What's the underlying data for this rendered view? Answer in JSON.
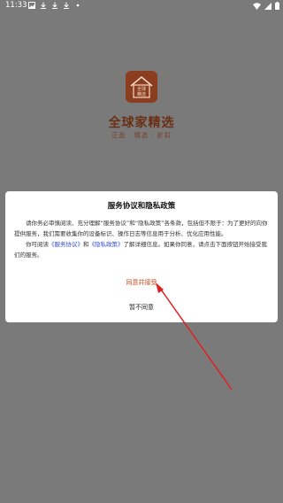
{
  "status_bar": {
    "time": "11:33"
  },
  "brand": {
    "logo_text": "全球\n精选",
    "name": "全球家精选",
    "slogan": "正品 · 精选 · 折扣"
  },
  "dialog": {
    "title": "服务协议和隐私政策",
    "para1": "请你务必审慎阅读、充分理解“服务协议”和“隐私政策”各条款，包括但不限于：为了更好的向你提供服务，我们需要收集你的设备标识、操作日志等信息用于分析、优化应用性能。",
    "para2_prefix": "你可阅读",
    "service_link": "《服务协议》",
    "para2_and": "和",
    "privacy_link": "《隐私政策》",
    "para2_suffix": "了解详细信息。如果你同意，请点击下面按钮开始接受我们的服务。",
    "agree_label": "同意并接受",
    "disagree_label": "暂不同意"
  },
  "colors": {
    "overlay": "#7a7a7a",
    "brand": "#8b3d1f",
    "agree": "#d2491c",
    "link": "#2d4bd1",
    "arrow": "#e02020"
  }
}
